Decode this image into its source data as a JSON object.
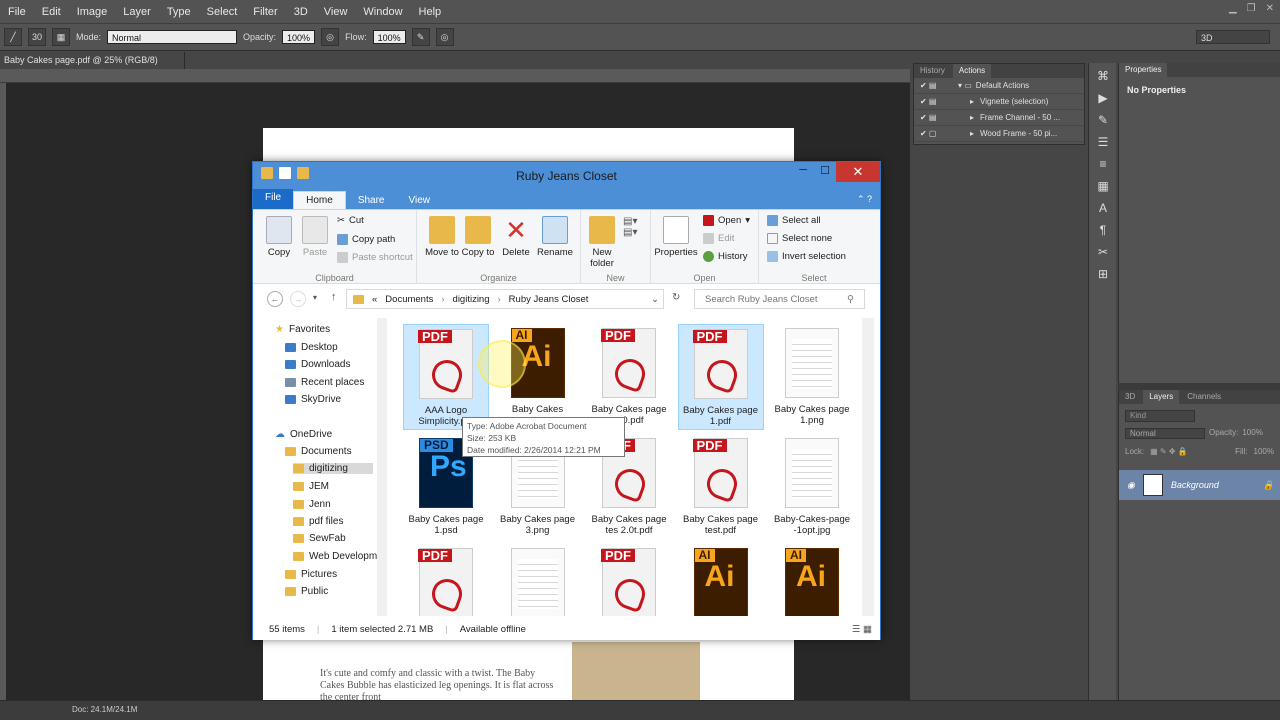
{
  "menubar": {
    "items": [
      "File",
      "Edit",
      "Image",
      "Layer",
      "Type",
      "Select",
      "Filter",
      "3D",
      "View",
      "Window",
      "Help"
    ]
  },
  "options": {
    "brush_size": "30",
    "mode_label": "Mode:",
    "mode_value": "Normal",
    "opacity_label": "Opacity:",
    "opacity_value": "100%",
    "flow_label": "Flow:",
    "flow_value": "100%",
    "workspace": "3D"
  },
  "document": {
    "tab": "Baby Cakes page.pdf @ 25% (RGB/8)",
    "text": "It's cute and comfy and classic with a twist. The Baby Cakes Bubble has elasticized leg openings. It is flat across the center front"
  },
  "status": {
    "doc": "Doc: 24.1M/24.1M"
  },
  "actions_panel": {
    "tabs": [
      "History",
      "Actions"
    ],
    "items": [
      "Default Actions",
      "Vignette (selection)",
      "Frame Channel - 50 ...",
      "Wood Frame - 50 pi..."
    ]
  },
  "properties_panel": {
    "title": "Properties",
    "empty": "No Properties"
  },
  "layers_panel": {
    "tabs": [
      "3D",
      "Layers",
      "Channels"
    ],
    "kind": "Kind",
    "blend": "Normal",
    "opacity_label": "Opacity:",
    "opacity_value": "100%",
    "lock_label": "Lock:",
    "fill_label": "Fill:",
    "fill_value": "100%",
    "layer_name": "Background"
  },
  "explorer": {
    "title": "Ruby Jeans Closet",
    "tabs": [
      "File",
      "Home",
      "Share",
      "View"
    ],
    "ribbon": {
      "clipboard": {
        "label": "Clipboard",
        "copy": "Copy",
        "paste": "Paste",
        "cut": "Cut",
        "copy_path": "Copy path",
        "paste_shortcut": "Paste shortcut"
      },
      "organize": {
        "label": "Organize",
        "move_to": "Move to",
        "copy_to": "Copy to",
        "delete": "Delete",
        "rename": "Rename"
      },
      "new": {
        "label": "New",
        "new_folder": "New folder"
      },
      "open": {
        "label": "Open",
        "properties": "Properties",
        "open": "Open",
        "edit": "Edit",
        "history": "History"
      },
      "select": {
        "label": "Select",
        "select_all": "Select all",
        "select_none": "Select none",
        "invert": "Invert selection"
      }
    },
    "address": {
      "prefix": "«",
      "crumbs": [
        "Documents",
        "digitizing",
        "Ruby Jeans Closet"
      ],
      "search_placeholder": "Search Ruby Jeans Closet"
    },
    "nav": {
      "favorites": "Favorites",
      "desktop": "Desktop",
      "downloads": "Downloads",
      "recent": "Recent places",
      "skydrive": "SkyDrive",
      "onedrive": "OneDrive",
      "documents": "Documents",
      "digitizing": "digitizing",
      "jem": "JEM",
      "jenn": "Jenn",
      "pdf_files": "pdf files",
      "sewfab": "SewFab",
      "webdev": "Web Developm",
      "pictures": "Pictures",
      "public": "Public"
    },
    "files": [
      {
        "name": "AAA Logo Simplicity.pdf",
        "type": "pdf"
      },
      {
        "name": "Baby Cakes",
        "type": "ai"
      },
      {
        "name": "Baby Cakes page ...0.pdf",
        "type": "pdf"
      },
      {
        "name": "Baby Cakes page 1.pdf",
        "type": "pdf"
      },
      {
        "name": "Baby Cakes page 1.png",
        "type": "png"
      },
      {
        "name": "Baby Cakes page 1.psd",
        "type": "ps"
      },
      {
        "name": "Baby Cakes page 3.png",
        "type": "png"
      },
      {
        "name": "Baby Cakes page tes 2.0t.pdf",
        "type": "pdf"
      },
      {
        "name": "Baby Cakes page test.pdf",
        "type": "pdf"
      },
      {
        "name": "Baby-Cakes-page -1opt.jpg",
        "type": "png"
      },
      {
        "name": "",
        "type": "pdf"
      },
      {
        "name": "",
        "type": "png"
      },
      {
        "name": "",
        "type": "pdf"
      },
      {
        "name": "",
        "type": "ai"
      },
      {
        "name": "",
        "type": "ai"
      }
    ],
    "tooltip": {
      "type": "Type: Adobe Acrobat Document",
      "size": "Size: 253 KB",
      "date": "Date modified: 2/26/2014 12:21 PM"
    },
    "statusbar": {
      "count": "55 items",
      "selected": "1 item selected  2.71 MB",
      "offline": "Available offline"
    }
  }
}
